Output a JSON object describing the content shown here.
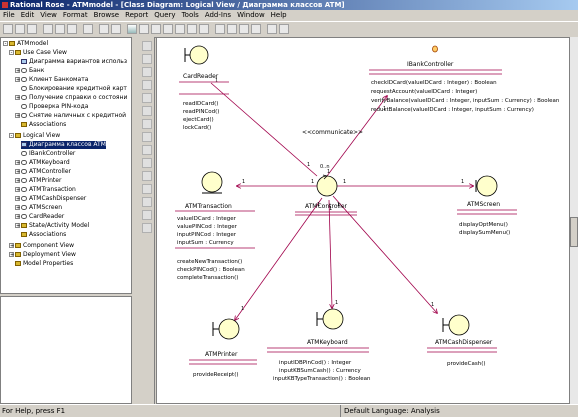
{
  "window": {
    "title": "Rational Rose - ATMmodel - [Class Diagram: Logical View / Диаграмма классов ATM]"
  },
  "menu": [
    "File",
    "Edit",
    "View",
    "Format",
    "Browse",
    "Report",
    "Query",
    "Tools",
    "Add-Ins",
    "Window",
    "Help"
  ],
  "tree": {
    "root": "ATMmodel",
    "use_case_view": "Use Case View",
    "use_case_items": [
      "Диаграмма вариантов использ",
      "Банк",
      "Клиент Банкомата",
      "Блокирование кредитной карт",
      "Получение справки о состояни",
      "Проверка PIN-кода",
      "Снятие наличных с кредитной",
      "Associations"
    ],
    "logical_view": "Logical View",
    "logical_items": [
      "Диаграмма классов ATM",
      "IBankController",
      "ATMKeyboard",
      "ATMController",
      "ATMPrinter",
      "ATMTransaction",
      "ATMCashDispenser",
      "ATMScreen",
      "CardReader",
      "State/Activity Model",
      "Associations"
    ],
    "other_items": [
      "Component View",
      "Deployment View",
      "Model Properties"
    ]
  },
  "diagram": {
    "classes": {
      "card_reader": {
        "name": "CardReader",
        "ops": [
          "readIDCard()",
          "readPINCod()",
          "ejectCard()",
          "lockCard()"
        ]
      },
      "ibank": {
        "name": "IBankController",
        "ops": [
          "checkIDCard(valueIDCard : Integer) : Boolean",
          "requestAccount(valueIDCard : Integer)",
          "verifyBalance(valueIDCard : Integer, inputSum : Currency) : Boolean",
          "reductBalance(valueIDCard : Integer, inputSum : Currency)"
        ]
      },
      "transaction": {
        "name": "ATMTransaction",
        "attrs": [
          "valueIDCard : Integer",
          "valuePINCod : Integer",
          "inputPINCod : Integer",
          "inputSum : Currency"
        ],
        "ops": [
          "createNewTransaction()",
          "checkPINCod() : Boolean",
          "completeTransaction()"
        ]
      },
      "controller": {
        "name": "ATMController"
      },
      "screen": {
        "name": "ATMScreen",
        "ops": [
          "displayOptMenu()",
          "displaySumMenu()"
        ]
      },
      "printer": {
        "name": "ATMPrinter",
        "ops": [
          "provideReceipt()"
        ]
      },
      "keyboard": {
        "name": "ATMKeyboard",
        "ops": [
          "inputIDBPinCod() : Integer",
          "inputKBSumCash() : Currency",
          "inputKBTypeTransaction() : Boolean"
        ]
      },
      "cash": {
        "name": "ATMCashDispenser",
        "ops": [
          "provideCash()"
        ]
      }
    },
    "stereotype": "<<communicate>>",
    "multiplicities": {
      "one": "1",
      "many": "0..n"
    }
  },
  "status": {
    "help": "For Help, press F1",
    "language": "Default Language: Analysis"
  }
}
